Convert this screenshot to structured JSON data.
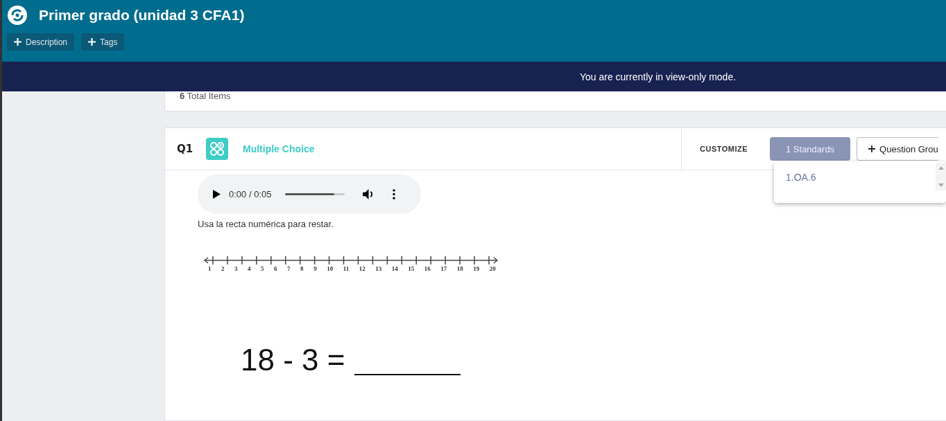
{
  "header": {
    "title": "Primer grado (unidad 3 CFA1)",
    "buttons": [
      "Description",
      "Tags"
    ]
  },
  "banner": "You are currently in view-only mode.",
  "summary": {
    "count": "6",
    "label": "Total Items"
  },
  "question": {
    "number": "Q1",
    "type": "Multiple Choice",
    "customize": "CUSTOMIZE",
    "standards_button": "1 Standards",
    "group_button": "Question Grou",
    "standards": [
      "1.OA.6"
    ],
    "audio": {
      "time": "0:00 / 0:05",
      "level": 0.82
    },
    "prompt": "Usa la recta numérica para restar.",
    "number_line": [
      "1",
      "2",
      "3",
      "4",
      "5",
      "6",
      "7",
      "8",
      "9",
      "10",
      "11",
      "12",
      "13",
      "14",
      "15",
      "16",
      "17",
      "18",
      "19",
      "20"
    ],
    "equation": "18 - 3 ="
  }
}
